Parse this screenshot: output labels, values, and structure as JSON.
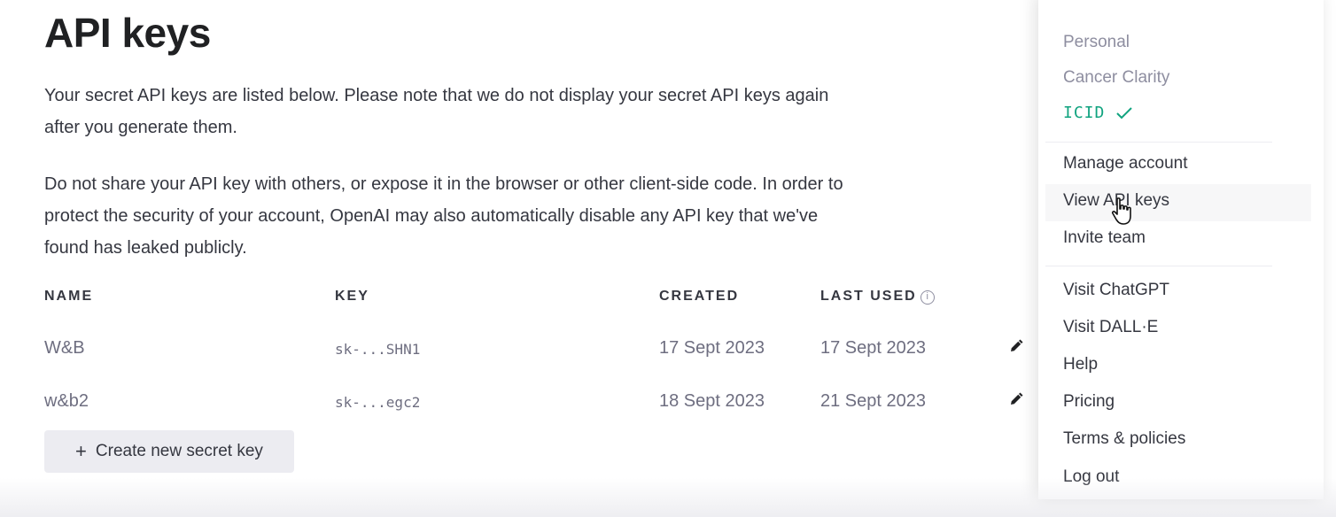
{
  "page": {
    "title": "API keys",
    "intro": [
      "Your secret API keys are listed below. Please note that we do not display your secret API keys again",
      "after you generate them."
    ],
    "warning": [
      "Do not share your API key with others, or expose it in the browser or other client-side code. In order to",
      "protect the security of your account, OpenAI may also automatically disable any API key that we've",
      "found has leaked publicly."
    ]
  },
  "table": {
    "headers": {
      "name": "NAME",
      "key": "KEY",
      "created": "CREATED",
      "last_used": "LAST USED"
    },
    "rows": [
      {
        "name": "W&B",
        "key": "sk-...SHN1",
        "created": "17 Sept 2023",
        "last_used": "17 Sept 2023"
      },
      {
        "name": "w&b2",
        "key": "sk-...egc2",
        "created": "18 Sept 2023",
        "last_used": "21 Sept 2023"
      }
    ]
  },
  "create_button": {
    "label": "Create new secret key"
  },
  "menu": {
    "organizations": [
      {
        "label": "Personal"
      },
      {
        "label": "Cancer Clarity"
      },
      {
        "label": "ICID",
        "selected": true
      }
    ],
    "account": [
      {
        "label": "Manage account"
      },
      {
        "label": "View API keys"
      },
      {
        "label": "Invite team"
      }
    ],
    "links": [
      {
        "label": "Visit ChatGPT"
      },
      {
        "label": "Visit DALL·E"
      },
      {
        "label": "Help"
      },
      {
        "label": "Pricing"
      },
      {
        "label": "Terms & policies"
      },
      {
        "label": "Log out"
      }
    ]
  },
  "colors": {
    "accent": "#10a37f",
    "text": "#353740",
    "muted": "#8e8ea0",
    "button_bg": "#ececf1"
  },
  "icons": {
    "edit": "pencil-icon",
    "info": "info-circle-icon",
    "check": "check-icon",
    "plus": "plus-icon",
    "cursor": "hand-pointer-icon"
  }
}
